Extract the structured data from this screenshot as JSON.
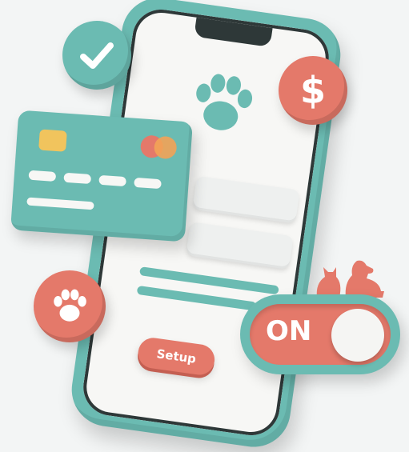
{
  "app": {
    "setup_button_label": "Setup",
    "toggle_label": "ON"
  },
  "icons": {
    "top_paw": "paw-icon",
    "check": "checkmark-icon",
    "dollar": "dollar-icon",
    "badge_paw": "paw-icon",
    "pets": "cat-and-dog-icon"
  },
  "colors": {
    "teal": "#6bbbb2",
    "coral": "#e4796a",
    "chip": "#f1c45d"
  },
  "dollar_symbol": "$"
}
